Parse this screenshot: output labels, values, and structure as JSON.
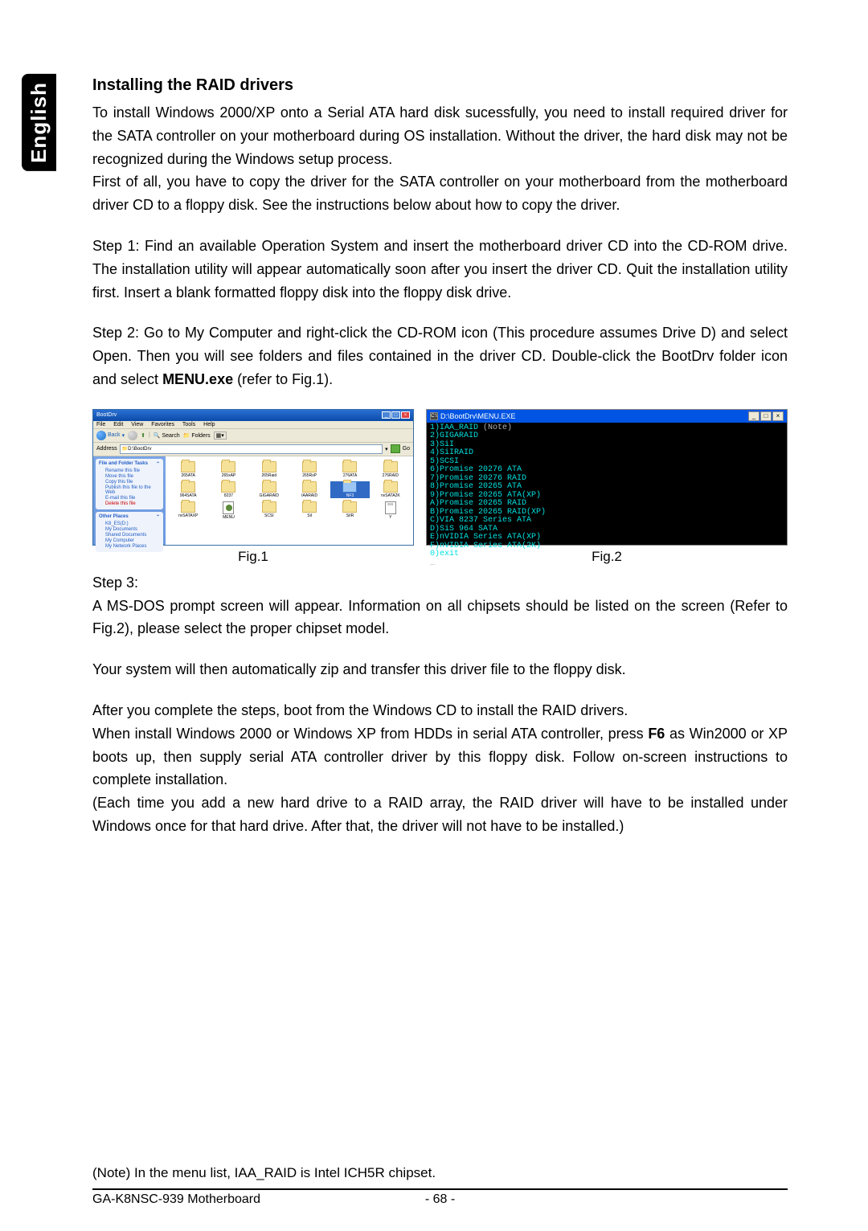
{
  "side_tab": "English",
  "heading": "Installing the RAID drivers",
  "para1": "To install Windows 2000/XP onto a Serial ATA hard disk sucessfully, you need to install required driver for the SATA controller on your motherboard during OS installation. Without the driver, the hard disk may not be recognized during the Windows setup process.",
  "para2": "First of all, you have to copy the driver for the SATA controller on your motherboard from the motherboard driver CD to a floppy disk. See the instructions below about how to copy the driver.",
  "para3": "Step 1: Find an available Operation System and insert the motherboard driver CD into the CD-ROM drive. The installation utility will appear automatically soon after you insert the driver CD. Quit the installation utility first. Insert a blank formatted floppy disk into the floppy disk drive.",
  "para4a": "Step 2: Go to My Computer and right-click the CD-ROM icon (This procedure assumes Drive D) and select Open. Then you will see folders and files contained in the driver CD. Double-click the BootDrv folder icon and select ",
  "para4b": "MENU.exe",
  "para4c": " (refer to Fig.1).",
  "fig1_label": "Fig.1",
  "fig2_label": "Fig.2",
  "step3_label": "Step 3:",
  "para5": "A MS-DOS prompt screen will appear. Information on all chipsets should be listed on the screen (Refer to Fig.2), please select the proper chipset model.",
  "para6": "Your system will then automatically zip and transfer this driver file to the floppy disk.",
  "para7": "After you complete the steps, boot from the Windows CD to install the RAID drivers.",
  "para8a": "When install Windows 2000 or Windows XP from HDDs in serial ATA controller, press ",
  "para8b": "F6",
  "para8c": " as Win2000 or XP boots up, then supply serial ATA controller driver by this floppy disk. Follow on-screen instructions to complete installation.",
  "para9": "(Each time you add a new hard drive to a RAID array, the RAID driver will have to be installed under Windows once for that hard drive. After that, the driver will not have to be installed.)",
  "footnote": "(Note)    In the menu list, IAA_RAID is Intel ICH5R chipset.",
  "footer_left": "GA-K8NSC-939 Motherboard",
  "footer_center": "- 68 -",
  "explorer": {
    "title": "BootDrv",
    "menu": [
      "File",
      "Edit",
      "View",
      "Favorites",
      "Tools",
      "Help"
    ],
    "back": "Back",
    "search": "Search",
    "folders": "Folders",
    "address_label": "Address",
    "address_value": "D:\\BootDrv",
    "go": "Go",
    "panel1_title": "File and Folder Tasks",
    "panel1_items": [
      "Rename this file",
      "Move this file",
      "Copy this file",
      "Publish this file to the Web",
      "E-mail this file",
      "Delete this file"
    ],
    "panel2_title": "Other Places",
    "panel2_items": [
      "K8_ES(D:)",
      "My Documents",
      "Shared Documents",
      "My Computer",
      "My Network Places"
    ],
    "folders_row": [
      "265ATA",
      "265xAP",
      "265Raid",
      "265RxP",
      "276ATA",
      "276RAID",
      "964SATA",
      "8237",
      "GIGARAID",
      "IAARAID",
      "NF3",
      "nvSATA2K",
      "nvSATAXP",
      "MENU",
      "SCSI",
      "SiI",
      "SiIR",
      "Y"
    ],
    "selected": "NF3"
  },
  "dos": {
    "title_path": "D:\\BootDrv\\MENU.EXE",
    "lines": [
      {
        "t": "1)IAA_RAID",
        "note": " (Note)"
      },
      {
        "t": "2)GIGARAID"
      },
      {
        "t": "3)SiI"
      },
      {
        "t": "4)SiIRAID"
      },
      {
        "t": "5)SCSI"
      },
      {
        "t": "6)Promise 20276 ATA"
      },
      {
        "t": "7)Promise 20276 RAID"
      },
      {
        "t": "8)Promise 20265 ATA"
      },
      {
        "t": "9)Promise 20265 ATA(XP)"
      },
      {
        "t": "A)Promise 20265 RAID"
      },
      {
        "t": "B)Promise 20265 RAID(XP)"
      },
      {
        "t": "C)VIA 8237 Series ATA"
      },
      {
        "t": "D)SiS 964 SATA"
      },
      {
        "t": "E)nVIDIA Series ATA(XP)"
      },
      {
        "t": "F)nVIDIA Series ATA(2K)"
      },
      {
        "t": "0)exit"
      }
    ]
  }
}
